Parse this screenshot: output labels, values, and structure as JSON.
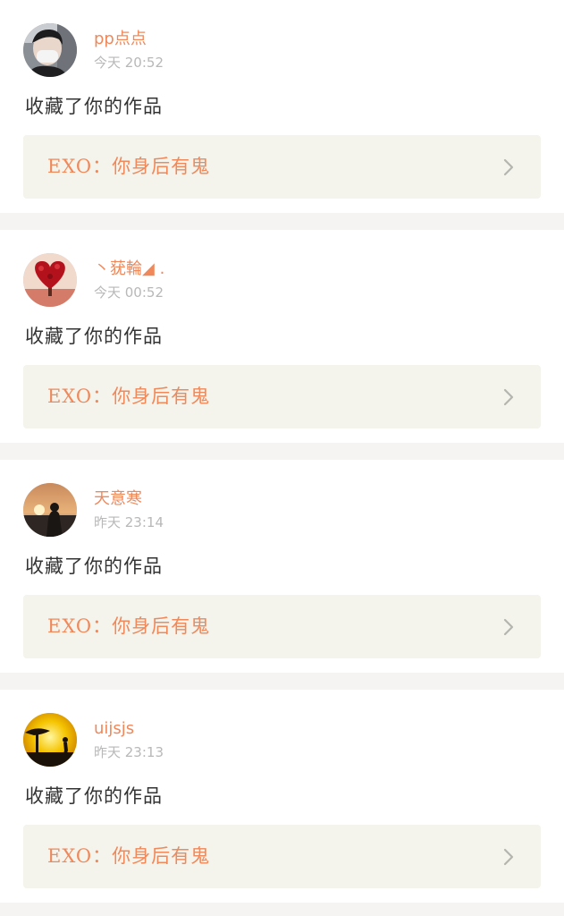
{
  "notifications": [
    {
      "username": "pp点点",
      "time": "今天 20:52",
      "action": "收藏了你的作品",
      "work_title": "EXO：你身后有鬼",
      "avatar_icon": "masked-person-avatar"
    },
    {
      "username": "丶莸輪◢ .",
      "time": "今天 00:52",
      "action": "收藏了你的作品",
      "work_title": "EXO：你身后有鬼",
      "avatar_icon": "red-heart-tree-avatar"
    },
    {
      "username": "天意寒",
      "time": "昨天 23:14",
      "action": "收藏了你的作品",
      "work_title": "EXO：你身后有鬼",
      "avatar_icon": "sunset-silhouette-avatar"
    },
    {
      "username": "uijsjs",
      "time": "昨天 23:13",
      "action": "收藏了你的作品",
      "work_title": "EXO：你身后有鬼",
      "avatar_icon": "sunset-runner-avatar"
    }
  ],
  "colors": {
    "accent": "#f0885a",
    "work_box_bg": "#f4f4ec",
    "separator": "#f5f4f2",
    "time_text": "#b8b8b8",
    "body_text": "#333333"
  }
}
